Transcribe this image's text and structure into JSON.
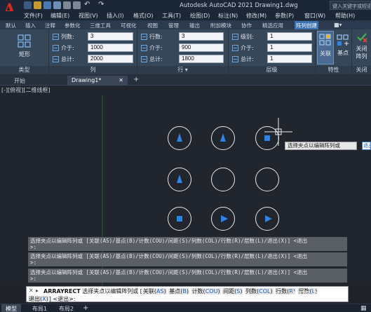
{
  "app": {
    "title": "Autodesk AutoCAD 2021    Drawing1.dwg",
    "search_placeholder": "键入关键字或短语",
    "logo_letter": "A"
  },
  "menu": [
    "文件(F)",
    "编辑(E)",
    "视图(V)",
    "插入(I)",
    "格式(O)",
    "工具(T)",
    "绘图(D)",
    "标注(N)",
    "修改(M)",
    "参数(P)",
    "窗口(W)",
    "帮助(H)"
  ],
  "ribbon_tabs": [
    "默认",
    "插入",
    "注释",
    "参数化",
    "三维工具",
    "可视化",
    "视图",
    "管理",
    "输出",
    "附加模块",
    "协作",
    "精选应用",
    "阵列创建"
  ],
  "ribbon_active_tab": "阵列创建",
  "ribbon": {
    "type_panel": {
      "button": "矩形",
      "label": "类型"
    },
    "column_panel": {
      "label": "列",
      "fields": [
        {
          "label": "列数:",
          "value": "3"
        },
        {
          "label": "介于:",
          "value": "1000"
        },
        {
          "label": "总计:",
          "value": "2000"
        }
      ]
    },
    "row_panel": {
      "label": "行 ▾",
      "fields": [
        {
          "label": "行数:",
          "value": "3"
        },
        {
          "label": "介于:",
          "value": "900"
        },
        {
          "label": "总计:",
          "value": "1800"
        }
      ]
    },
    "level_panel": {
      "label": "层级",
      "fields": [
        {
          "label": "级别:",
          "value": "1"
        },
        {
          "label": "介于:",
          "value": "1"
        },
        {
          "label": "总计:",
          "value": "1"
        }
      ]
    },
    "props_panel": {
      "label": "特性",
      "associate": "关联",
      "base_point": "基点"
    },
    "close_panel": {
      "close": "关闭",
      "close2": "阵列",
      "label": "关闭"
    }
  },
  "doc_tabs": {
    "start": "开始",
    "drawing": "Drawing1*"
  },
  "view_label": "[-][俯视][二维线框]",
  "grid": {
    "markers": [
      [
        "triangle-up",
        "triangle-up",
        "square"
      ],
      [
        "triangle-up",
        "none",
        "none"
      ],
      [
        "square",
        "triangle-right",
        "triangle-right"
      ]
    ]
  },
  "tooltip": {
    "text": "选择夹点以编辑阵列或",
    "input": "退出"
  },
  "history": [
    "选择夹点以编辑阵列或 [关联(AS)/基点(B)/计数(COU)/间距(S)/列数(COL)/行数(R)/层数(L)/退出(X)] <退出",
    ">:",
    "选择夹点以编辑阵列或 [关联(AS)/基点(B)/计数(COU)/间距(S)/列数(COL)/行数(R)/层数(L)/退出(X)] <退出",
    ">:",
    "选择夹点以编辑阵列或 [关联(AS)/基点(B)/计数(COU)/间距(S)/列数(COL)/行数(R)/层数(L)/退出(X)] <退出",
    ">:"
  ],
  "command": {
    "name": "ARRAYRECT",
    "prompt": "选择夹点以编辑阵列或 [",
    "options": [
      {
        "text": "关联(",
        "key": "AS",
        "close": ")"
      },
      {
        "text": "基点(",
        "key": "B",
        "close": ")"
      },
      {
        "text": "计数(",
        "key": "COU",
        "close": ")"
      },
      {
        "text": "间距(",
        "key": "S",
        "close": ")"
      },
      {
        "text": "列数(",
        "key": "COL",
        "close": ")"
      },
      {
        "text": "行数(",
        "key": "R",
        "close": ")"
      },
      {
        "text": "层数(",
        "key": "L",
        "close": ")"
      }
    ],
    "line2_opt": {
      "text": "退出(",
      "key": "X",
      "close": ")"
    },
    "line2_tail": "] <退出>:"
  },
  "status_tabs": [
    "模型",
    "布局1",
    "布局2"
  ],
  "watermark": "知乎 @文星柒",
  "colors": {
    "accent": "#3a6fb0",
    "grip": "#2f83e6"
  }
}
